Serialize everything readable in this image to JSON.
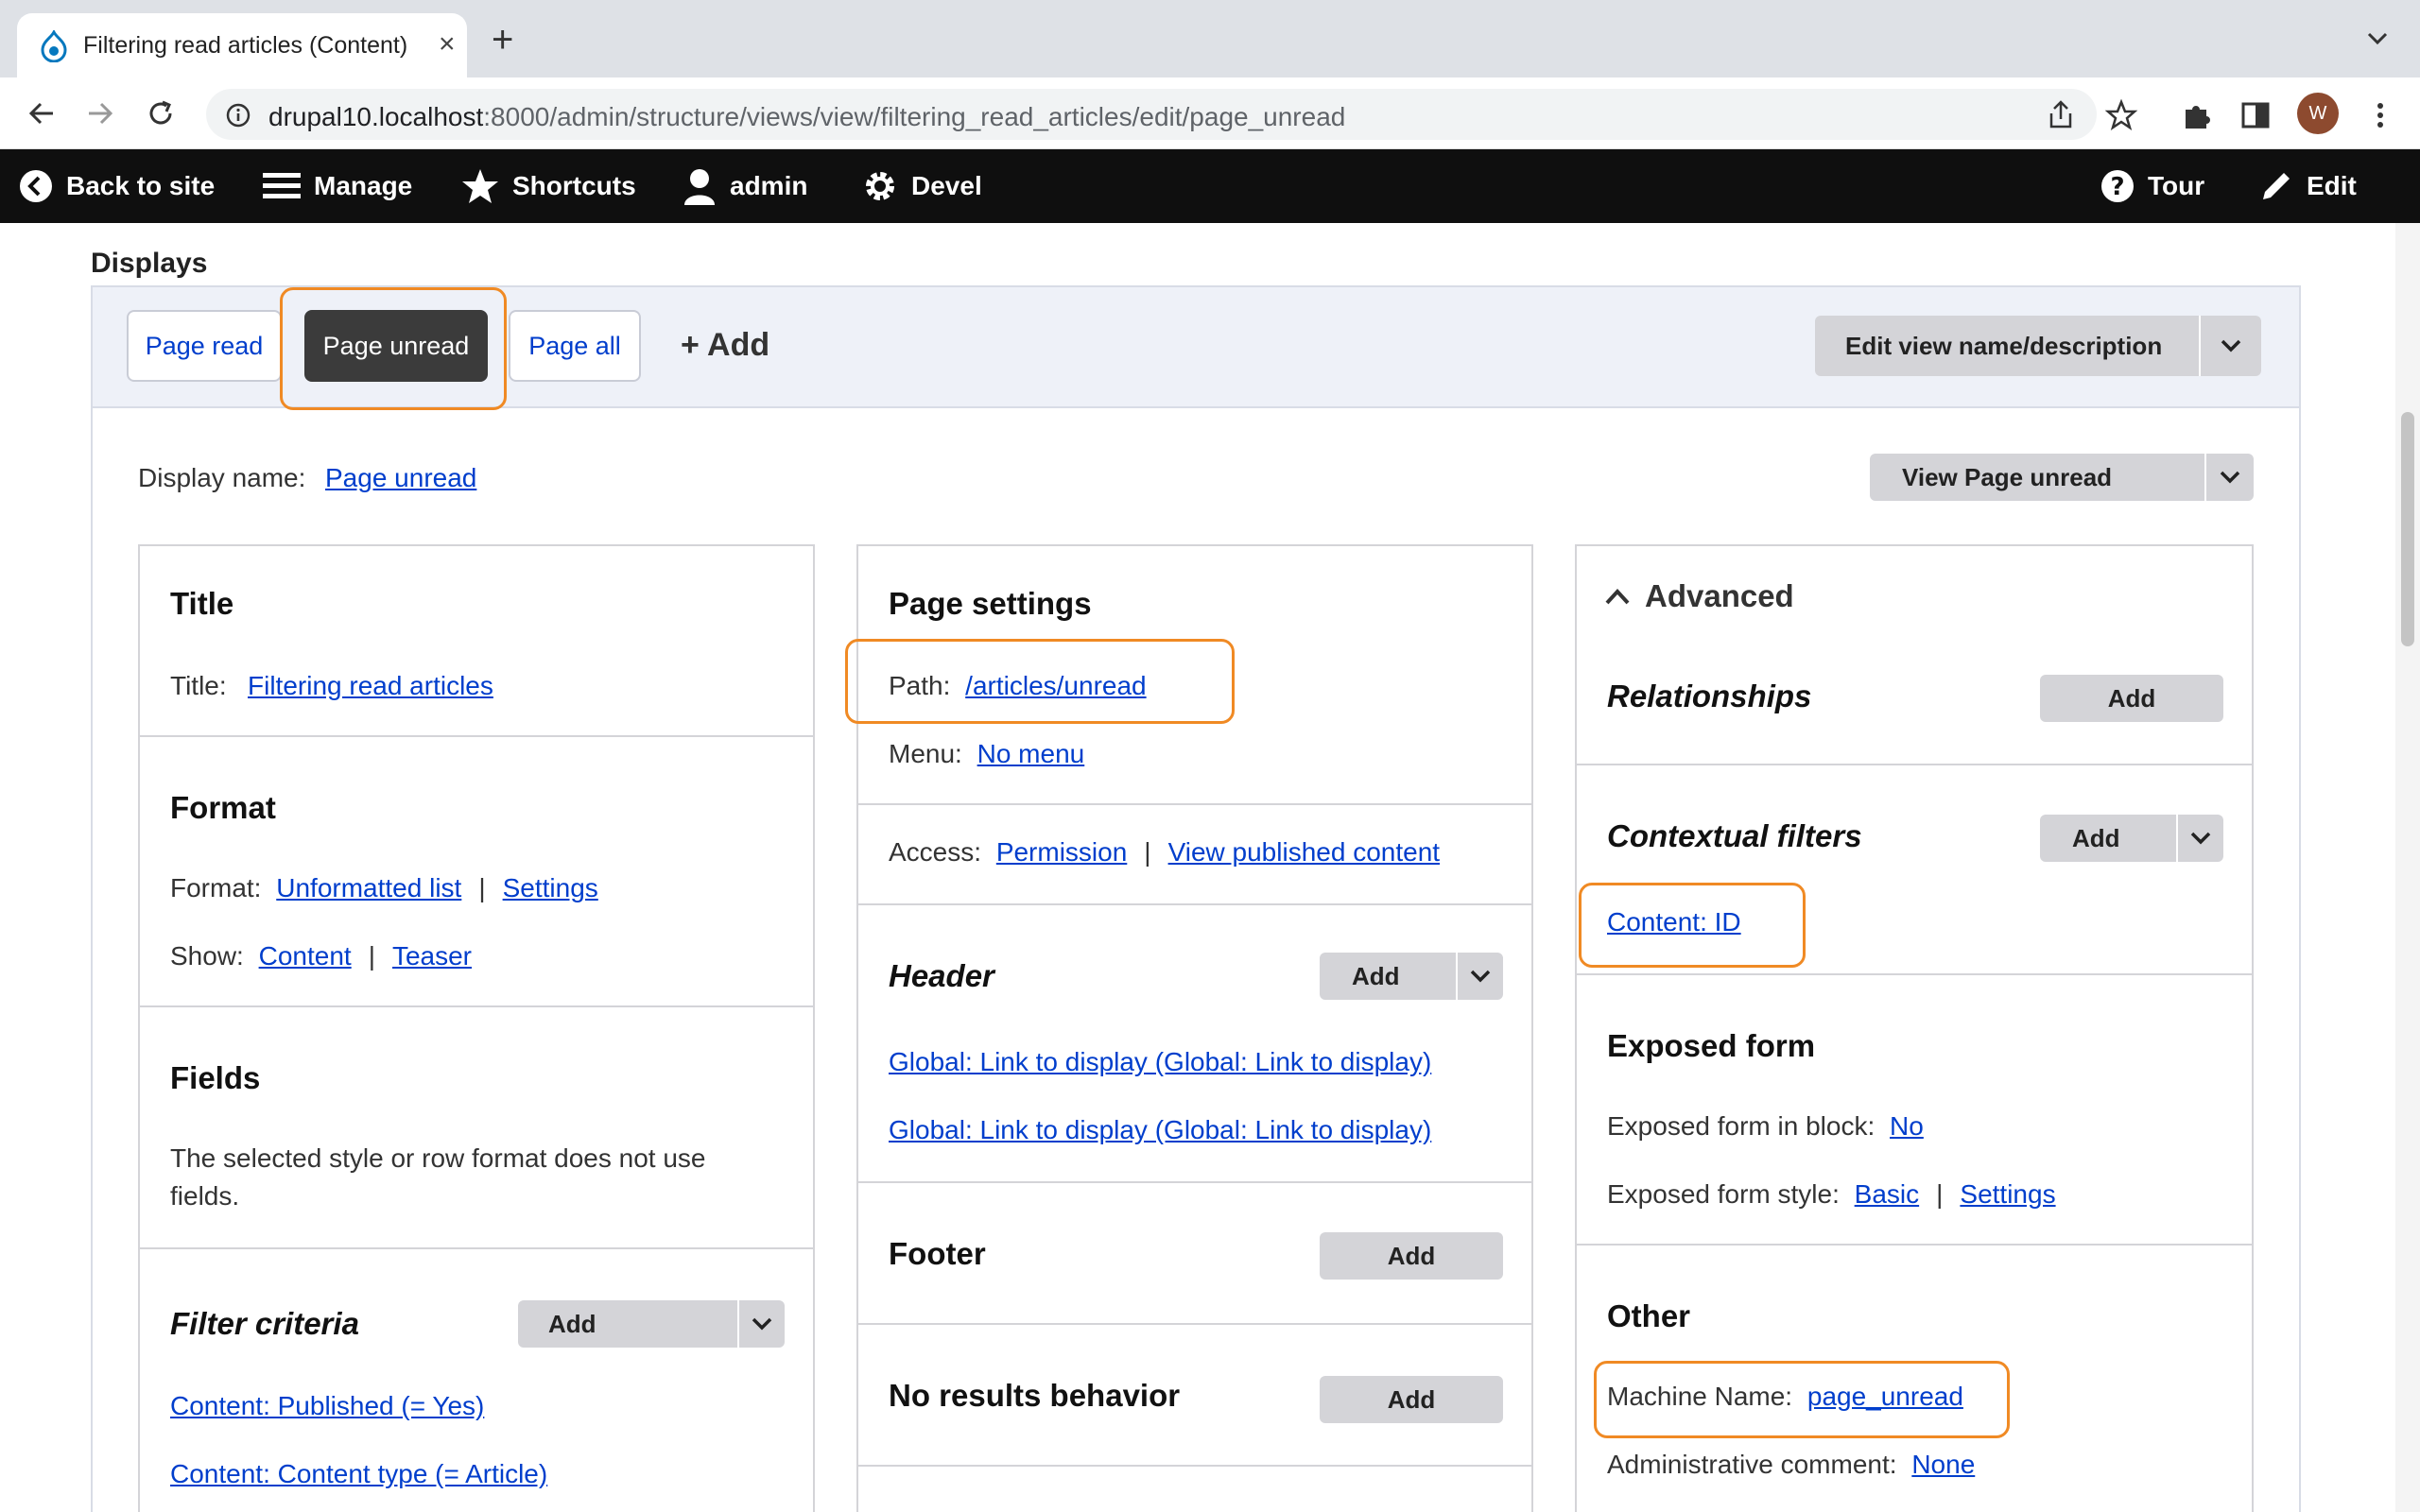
{
  "browser": {
    "tab_title": "Filtering read articles (Content)",
    "url_host": "drupal10.localhost",
    "url_rest": ":8000/admin/structure/views/view/filtering_read_articles/edit/page_unread",
    "avatar_letter": "W"
  },
  "toolbar": {
    "back": "Back to site",
    "manage": "Manage",
    "shortcuts": "Shortcuts",
    "user": "admin",
    "devel": "Devel",
    "tour": "Tour",
    "edit": "Edit"
  },
  "displays": {
    "heading": "Displays",
    "tabs": [
      "Page read",
      "Page unread",
      "Page all"
    ],
    "add": "+ Add",
    "edit_name_btn": "Edit view name/description",
    "display_name_label": "Display name:",
    "display_name_value": "Page unread",
    "view_btn": "View Page unread"
  },
  "col1": {
    "title_heading": "Title",
    "title_label": "Title:",
    "title_value": "Filtering read articles",
    "format_heading": "Format",
    "format_label": "Format:",
    "format_value": "Unformatted list",
    "format_settings": "Settings",
    "show_label": "Show:",
    "show_value": "Content",
    "show_mode": "Teaser",
    "fields_heading": "Fields",
    "fields_text_1": "The selected style or row format does not use",
    "fields_text_2": "fields.",
    "filter_heading": "Filter criteria",
    "filter_add": "Add",
    "filter_1": "Content: Published (= Yes)",
    "filter_2": "Content: Content type (= Article)"
  },
  "col2": {
    "page_settings_heading": "Page settings",
    "path_label": "Path:",
    "path_value": "/articles/unread",
    "menu_label": "Menu:",
    "menu_value": "No menu",
    "access_label": "Access:",
    "access_value": "Permission",
    "access_perm": "View published content",
    "header_heading": "Header",
    "header_add": "Add",
    "header_1": "Global: Link to display (Global: Link to display)",
    "header_2": "Global: Link to display (Global: Link to display)",
    "footer_heading": "Footer",
    "footer_add": "Add",
    "noresults_heading": "No results behavior",
    "noresults_add": "Add"
  },
  "col3": {
    "advanced_heading": "Advanced",
    "relationships_heading": "Relationships",
    "relationships_add": "Add",
    "contextual_heading": "Contextual filters",
    "contextual_add": "Add",
    "contextual_1": "Content: ID",
    "exposed_heading": "Exposed form",
    "exposed_block_label": "Exposed form in block:",
    "exposed_block_value": "No",
    "exposed_style_label": "Exposed form style:",
    "exposed_style_value": "Basic",
    "exposed_style_settings": "Settings",
    "other_heading": "Other",
    "machine_label": "Machine Name:",
    "machine_value": "page_unread",
    "admin_comment_label": "Administrative comment:",
    "admin_comment_value": "None"
  },
  "colors": {
    "highlight": "#f08a24",
    "link": "#003ecc",
    "toolbar": "#0f0f0f"
  }
}
